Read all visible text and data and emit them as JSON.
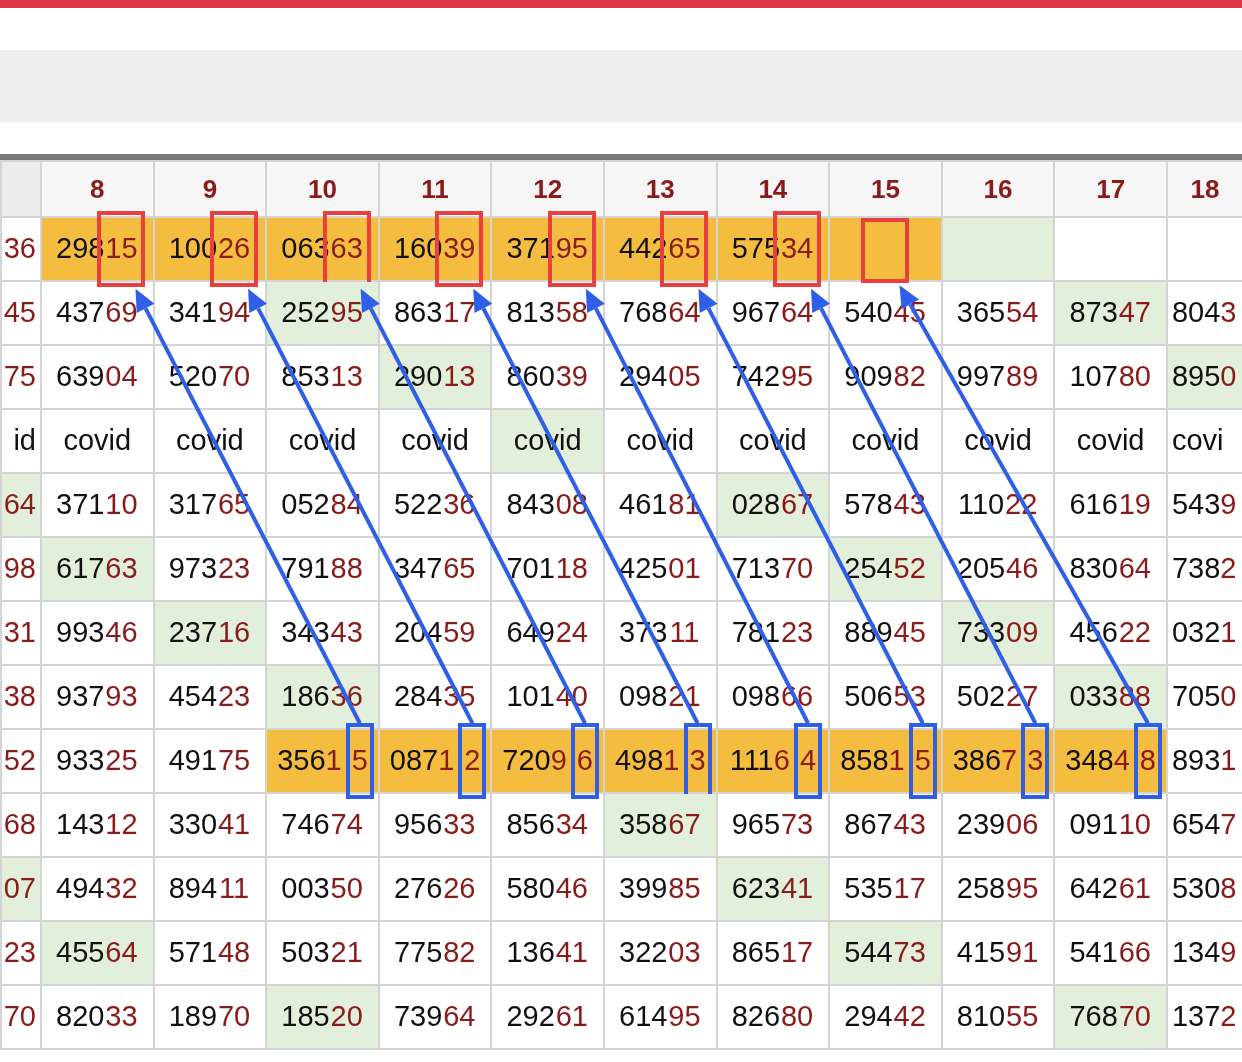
{
  "columns": [
    {
      "label": "8"
    },
    {
      "label": "9"
    },
    {
      "label": "10"
    },
    {
      "label": "11"
    },
    {
      "label": "12"
    },
    {
      "label": "13"
    },
    {
      "label": "14"
    },
    {
      "label": "15"
    },
    {
      "label": "16"
    },
    {
      "label": "17"
    },
    {
      "label": "18"
    }
  ],
  "rows": [
    {
      "cells": [
        {
          "tail": "36"
        },
        {
          "head": "298",
          "tail": "15",
          "color": "#f5bd3f",
          "pair_framed": true
        },
        {
          "head": "100",
          "tail": "26",
          "color": "#f5bd3f",
          "pair_framed": true
        },
        {
          "head": "063",
          "tail": "63",
          "color": "#f5bd3f",
          "pair_framed": true
        },
        {
          "head": "160",
          "tail": "39",
          "color": "#f5bd3f",
          "pair_framed": true
        },
        {
          "head": "371",
          "tail": "95",
          "color": "#f5bd3f",
          "pair_framed": true
        },
        {
          "head": "442",
          "tail": "65",
          "color": "#f5bd3f",
          "pair_framed": true
        },
        {
          "head": "575",
          "tail": "34",
          "color": "#f5bd3f",
          "pair_framed": true
        },
        {
          "color": "#f5bd3f",
          "pair_framed": true
        },
        {
          "color": "#e2efda"
        },
        {},
        {}
      ]
    },
    {
      "cells": [
        {
          "tail": "45"
        },
        {
          "head": "437",
          "tail": "69"
        },
        {
          "head": "341",
          "tail": "94"
        },
        {
          "head": "252",
          "tail": "95",
          "color": "#e2efda"
        },
        {
          "head": "863",
          "tail": "17"
        },
        {
          "head": "813",
          "tail": "58"
        },
        {
          "head": "768",
          "tail": "64"
        },
        {
          "head": "967",
          "tail": "64"
        },
        {
          "head": "540",
          "tail": "45"
        },
        {
          "head": "365",
          "tail": "54"
        },
        {
          "head": "873",
          "tail": "47",
          "color": "#e2efda"
        },
        {
          "head": "804",
          "tail": "3"
        }
      ]
    },
    {
      "cells": [
        {
          "tail": "75"
        },
        {
          "head": "639",
          "tail": "04"
        },
        {
          "head": "520",
          "tail": "70"
        },
        {
          "head": "853",
          "tail": "13"
        },
        {
          "head": "290",
          "tail": "13",
          "color": "#e2efda"
        },
        {
          "head": "860",
          "tail": "39"
        },
        {
          "head": "294",
          "tail": "05"
        },
        {
          "head": "742",
          "tail": "95"
        },
        {
          "head": "909",
          "tail": "82"
        },
        {
          "head": "997",
          "tail": "89"
        },
        {
          "head": "107",
          "tail": "80"
        },
        {
          "head": "895",
          "tail": "0",
          "color": "#e2efda"
        }
      ]
    },
    {
      "cells": [
        {
          "head": "id"
        },
        {
          "head": "covid"
        },
        {
          "head": "covid"
        },
        {
          "head": "covid"
        },
        {
          "head": "covid"
        },
        {
          "head": "covid",
          "color": "#e2efda"
        },
        {
          "head": "covid"
        },
        {
          "head": "covid"
        },
        {
          "head": "covid"
        },
        {
          "head": "covid"
        },
        {
          "head": "covid"
        },
        {
          "head": "covi"
        }
      ]
    },
    {
      "cells": [
        {
          "tail": "64",
          "color": "#e2efda"
        },
        {
          "head": "371",
          "tail": "10"
        },
        {
          "head": "317",
          "tail": "65"
        },
        {
          "head": "052",
          "tail": "84"
        },
        {
          "head": "522",
          "tail": "36"
        },
        {
          "head": "843",
          "tail": "08"
        },
        {
          "head": "461",
          "tail": "81"
        },
        {
          "head": "028",
          "tail": "67",
          "color": "#e2efda"
        },
        {
          "head": "578",
          "tail": "43"
        },
        {
          "head": "110",
          "tail": "22"
        },
        {
          "head": "616",
          "tail": "19"
        },
        {
          "head": "543",
          "tail": "9"
        }
      ]
    },
    {
      "cells": [
        {
          "tail": "98"
        },
        {
          "head": "617",
          "tail": "63",
          "color": "#e2efda"
        },
        {
          "head": "973",
          "tail": "23"
        },
        {
          "head": "791",
          "tail": "88"
        },
        {
          "head": "347",
          "tail": "65"
        },
        {
          "head": "701",
          "tail": "18"
        },
        {
          "head": "425",
          "tail": "01"
        },
        {
          "head": "713",
          "tail": "70"
        },
        {
          "head": "254",
          "tail": "52",
          "color": "#e2efda"
        },
        {
          "head": "205",
          "tail": "46"
        },
        {
          "head": "830",
          "tail": "64"
        },
        {
          "head": "738",
          "tail": "2"
        }
      ]
    },
    {
      "cells": [
        {
          "tail": "31"
        },
        {
          "head": "993",
          "tail": "46"
        },
        {
          "head": "237",
          "tail": "16",
          "color": "#e2efda"
        },
        {
          "head": "343",
          "tail": "43"
        },
        {
          "head": "204",
          "tail": "59"
        },
        {
          "head": "649",
          "tail": "24"
        },
        {
          "head": "373",
          "tail": "11"
        },
        {
          "head": "781",
          "tail": "23"
        },
        {
          "head": "889",
          "tail": "45"
        },
        {
          "head": "733",
          "tail": "09",
          "color": "#e2efda"
        },
        {
          "head": "456",
          "tail": "22"
        },
        {
          "head": "032",
          "tail": "1"
        }
      ]
    },
    {
      "cells": [
        {
          "tail": "38"
        },
        {
          "head": "937",
          "tail": "93"
        },
        {
          "head": "454",
          "tail": "23"
        },
        {
          "head": "186",
          "tail": "36",
          "color": "#e2efda"
        },
        {
          "head": "284",
          "tail": "35"
        },
        {
          "head": "101",
          "tail": "40"
        },
        {
          "head": "098",
          "tail": "21"
        },
        {
          "head": "098",
          "tail": "66"
        },
        {
          "head": "506",
          "tail": "53"
        },
        {
          "head": "502",
          "tail": "27"
        },
        {
          "head": "033",
          "tail": "88",
          "color": "#e2efda"
        },
        {
          "head": "705",
          "tail": "0"
        }
      ]
    },
    {
      "cells": [
        {
          "tail": "52"
        },
        {
          "head": "933",
          "tail": "25"
        },
        {
          "head": "491",
          "tail": "75"
        },
        {
          "head": "356",
          "tail": "15",
          "color": "#f5bd3f",
          "digit_framed": true
        },
        {
          "head": "087",
          "tail": "12",
          "color": "#f5bd3f",
          "digit_framed": true
        },
        {
          "head": "720",
          "tail": "96",
          "color": "#f5bd3f",
          "digit_framed": true
        },
        {
          "head": "498",
          "tail": "13",
          "color": "#f5bd3f",
          "digit_framed": true
        },
        {
          "head": "111",
          "tail": "64",
          "color": "#f5bd3f",
          "digit_framed": true
        },
        {
          "head": "858",
          "tail": "15",
          "color": "#f5bd3f",
          "digit_framed": true
        },
        {
          "head": "386",
          "tail": "73",
          "color": "#f5bd3f",
          "digit_framed": true
        },
        {
          "head": "348",
          "tail": "48",
          "color": "#f5bd3f",
          "digit_framed": true
        },
        {
          "head": "893",
          "tail": "1"
        }
      ]
    },
    {
      "cells": [
        {
          "tail": "68"
        },
        {
          "head": "143",
          "tail": "12"
        },
        {
          "head": "330",
          "tail": "41"
        },
        {
          "head": "746",
          "tail": "74"
        },
        {
          "head": "956",
          "tail": "33"
        },
        {
          "head": "856",
          "tail": "34"
        },
        {
          "head": "358",
          "tail": "67",
          "color": "#e2efda"
        },
        {
          "head": "965",
          "tail": "73"
        },
        {
          "head": "867",
          "tail": "43"
        },
        {
          "head": "239",
          "tail": "06"
        },
        {
          "head": "091",
          "tail": "10"
        },
        {
          "head": "654",
          "tail": "7"
        }
      ]
    },
    {
      "cells": [
        {
          "tail": "07",
          "color": "#e2efda"
        },
        {
          "head": "494",
          "tail": "32"
        },
        {
          "head": "894",
          "tail": "11"
        },
        {
          "head": "003",
          "tail": "50"
        },
        {
          "head": "276",
          "tail": "26"
        },
        {
          "head": "580",
          "tail": "46"
        },
        {
          "head": "399",
          "tail": "85"
        },
        {
          "head": "623",
          "tail": "41",
          "color": "#e2efda"
        },
        {
          "head": "535",
          "tail": "17"
        },
        {
          "head": "258",
          "tail": "95"
        },
        {
          "head": "642",
          "tail": "61"
        },
        {
          "head": "530",
          "tail": "8"
        }
      ]
    },
    {
      "cells": [
        {
          "tail": "23"
        },
        {
          "head": "455",
          "tail": "64",
          "color": "#e2efda"
        },
        {
          "head": "571",
          "tail": "48"
        },
        {
          "head": "503",
          "tail": "21"
        },
        {
          "head": "775",
          "tail": "82"
        },
        {
          "head": "136",
          "tail": "41"
        },
        {
          "head": "322",
          "tail": "03"
        },
        {
          "head": "865",
          "tail": "17"
        },
        {
          "head": "544",
          "tail": "73",
          "color": "#e2efda"
        },
        {
          "head": "415",
          "tail": "91"
        },
        {
          "head": "541",
          "tail": "66"
        },
        {
          "head": "134",
          "tail": "9"
        }
      ]
    },
    {
      "cells": [
        {
          "tail": "70"
        },
        {
          "head": "820",
          "tail": "33"
        },
        {
          "head": "189",
          "tail": "70"
        },
        {
          "head": "185",
          "tail": "20",
          "color": "#e2efda"
        },
        {
          "head": "739",
          "tail": "64"
        },
        {
          "head": "292",
          "tail": "61"
        },
        {
          "head": "614",
          "tail": "95"
        },
        {
          "head": "826",
          "tail": "80"
        },
        {
          "head": "294",
          "tail": "42"
        },
        {
          "head": "810",
          "tail": "55"
        },
        {
          "head": "768",
          "tail": "70",
          "color": "#e2efda"
        },
        {
          "head": "137",
          "tail": "2"
        }
      ]
    }
  ]
}
